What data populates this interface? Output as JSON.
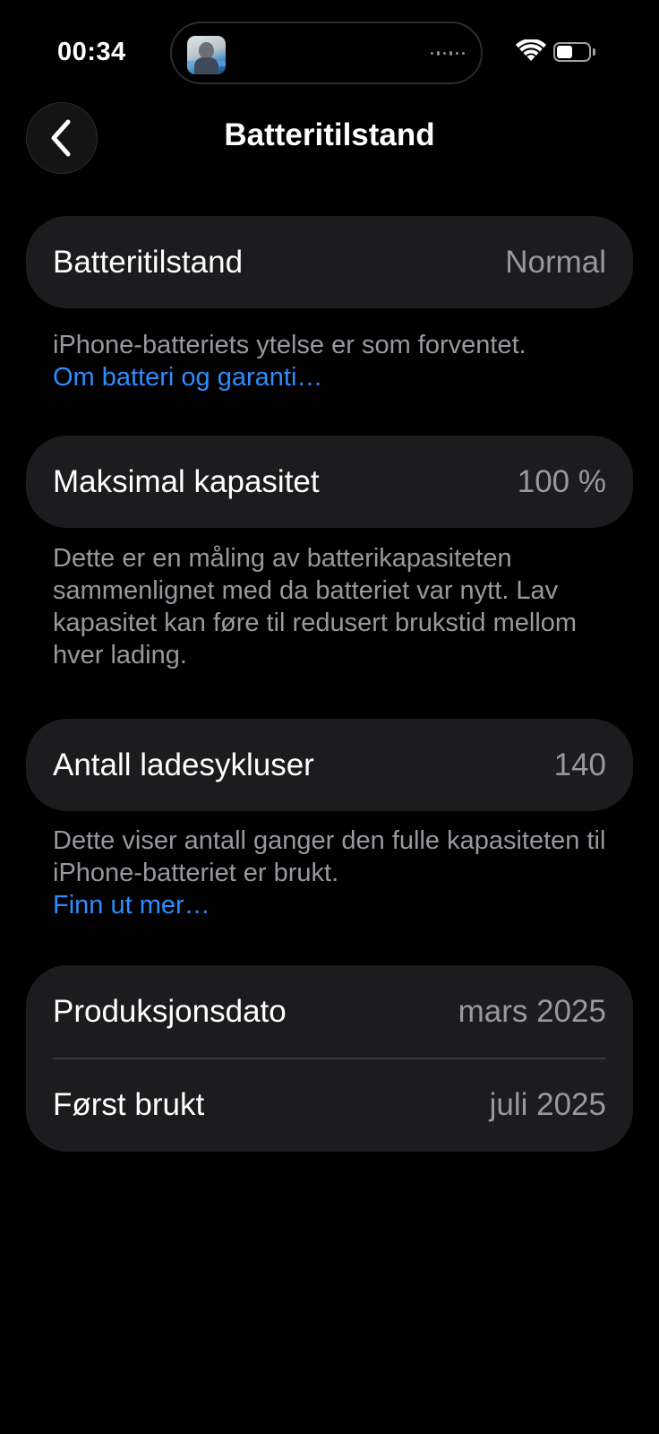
{
  "status_bar": {
    "time": "00:34",
    "battery_level": 0.5
  },
  "nav": {
    "title": "Batteritilstand"
  },
  "sections": {
    "health": {
      "label": "Batteritilstand",
      "value": "Normal",
      "footnote": "iPhone-batteriets ytelse er som forventet.",
      "link": "Om batteri og garanti…"
    },
    "capacity": {
      "label": "Maksimal kapasitet",
      "value": "100 %",
      "footnote": "Dette er en måling av batterikapasiteten sammenlignet med da batteriet var nytt. Lav kapasitet kan føre til redusert brukstid mellom hver lading."
    },
    "cycles": {
      "label": "Antall ladesykluser",
      "value": "140",
      "footnote": "Dette viser antall ganger den fulle kapasiteten til iPhone-batteriet er brukt.",
      "link": "Finn ut mer…"
    },
    "dates": {
      "manufacture_label": "Produksjonsdato",
      "manufacture_value": "mars 2025",
      "first_use_label": "Først brukt",
      "first_use_value": "juli 2025"
    }
  },
  "colors": {
    "background": "#000000",
    "card": "#1c1c1e",
    "secondary_text": "#98989f",
    "link": "#2f8cff"
  },
  "icons": {
    "back": "chevron-left-icon",
    "wifi": "wifi-icon",
    "battery": "battery-icon",
    "now_playing": "album-art-icon"
  }
}
